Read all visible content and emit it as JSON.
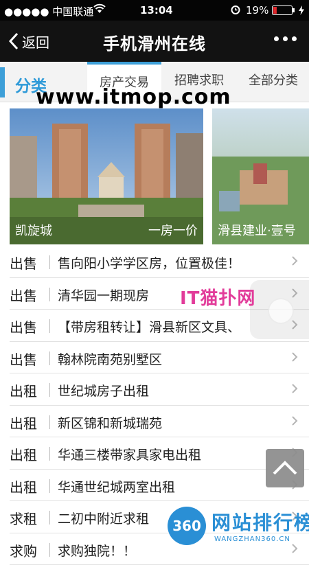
{
  "status_bar": {
    "carrier": "●●●●● 中国联通",
    "time": "13:04",
    "battery_percent": "19%",
    "battery_level": 0.19
  },
  "nav": {
    "back_label": "返回",
    "title": "手机滑州在线"
  },
  "tabs": {
    "category_label": "分类",
    "items": [
      {
        "label": "房产交易"
      },
      {
        "label": "招聘求职"
      },
      {
        "label": "全部分类"
      }
    ]
  },
  "watermarks": {
    "top": "www.itmop.com",
    "middle": "IT猫扑网",
    "badge_circle": "360",
    "badge_main": "网站排行榜",
    "badge_sub": "WANGZHAN360.CN"
  },
  "cards": [
    {
      "name": "凯旋城",
      "tag": "一房一价"
    },
    {
      "name": "滑县建业·壹号"
    }
  ],
  "listings": [
    {
      "type": "出售",
      "title": "售向阳小学学区房，位置极佳！"
    },
    {
      "type": "出售",
      "title": "清华园一期现房"
    },
    {
      "type": "出售",
      "title": "【带房租转让】滑县新区文具、"
    },
    {
      "type": "出售",
      "title": "翰林院南苑别墅区"
    },
    {
      "type": "出租",
      "title": "世纪城房子出租"
    },
    {
      "type": "出租",
      "title": "新区锦和新城瑞苑"
    },
    {
      "type": "出租",
      "title": "华通三楼带家具家电出租"
    },
    {
      "type": "出租",
      "title": "华通世纪城两室出租"
    },
    {
      "type": "求租",
      "title": "二初中附近求租"
    },
    {
      "type": "求购",
      "title": "求购独院！！"
    }
  ],
  "colors": {
    "accent": "#3d9fd8",
    "nav_bg": "#121212",
    "battery_red": "#e0262b",
    "watermark_pink": "#e23c9a"
  }
}
